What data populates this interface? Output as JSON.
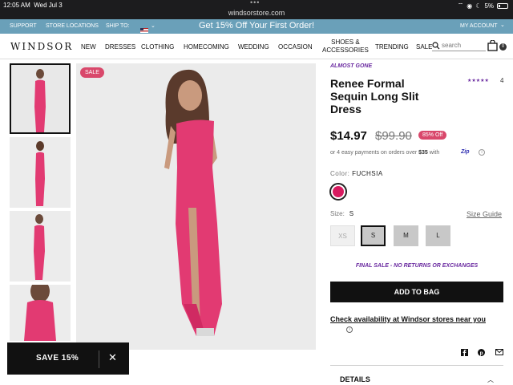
{
  "statusbar": {
    "time": "12:05 AM",
    "date": "Wed Jul 3",
    "url": "windsorstore.com",
    "battery": "5%"
  },
  "promo": {
    "support": "SUPPORT",
    "store_locations": "STORE LOCATIONS",
    "ship_to": "SHIP TO:",
    "message": "Get 15% Off Your First Order!",
    "my_account": "MY ACCOUNT"
  },
  "nav": {
    "logo": "WINDSOR",
    "items": [
      "NEW",
      "DRESSES",
      "CLOTHING",
      "HOMECOMING",
      "WEDDING",
      "OCCASION"
    ],
    "shoes_line1": "SHOES &",
    "shoes_line2": "ACCESSORIES",
    "trending": "TRENDING",
    "sale": "SALE",
    "search_placeholder": "search",
    "bag_count": "0"
  },
  "gallery": {
    "sale_badge": "SALE"
  },
  "product": {
    "status": "ALMOST GONE",
    "title": "Renee Formal Sequin Long Slit Dress",
    "stars": "★★★★★",
    "reviews": "4",
    "price": "$14.97",
    "original_price": "$99.90",
    "discount": "85% Off",
    "pay_prefix": "or 4 easy payments on orders over",
    "pay_amount": "$35",
    "pay_suffix": "with",
    "zip_logo": "Zip",
    "color_label": "Color:",
    "color_value": "FUCHSIA",
    "size_label": "Size:",
    "size_value": "S",
    "size_guide": "Size Guide",
    "sizes": [
      "XS",
      "S",
      "M",
      "L"
    ],
    "final_sale": "FINAL SALE - NO RETURNS OR EXCHANGES",
    "add_to_bag": "ADD TO BAG",
    "availability": "Check availability at Windsor stores near you",
    "details": "DETAILS"
  },
  "popup": {
    "label": "SAVE 15%"
  },
  "colors": {
    "accent": "#d9486b",
    "purple": "#6a2aa0",
    "promo_bar": "#6aa0b9",
    "dress": "#e23a72"
  }
}
